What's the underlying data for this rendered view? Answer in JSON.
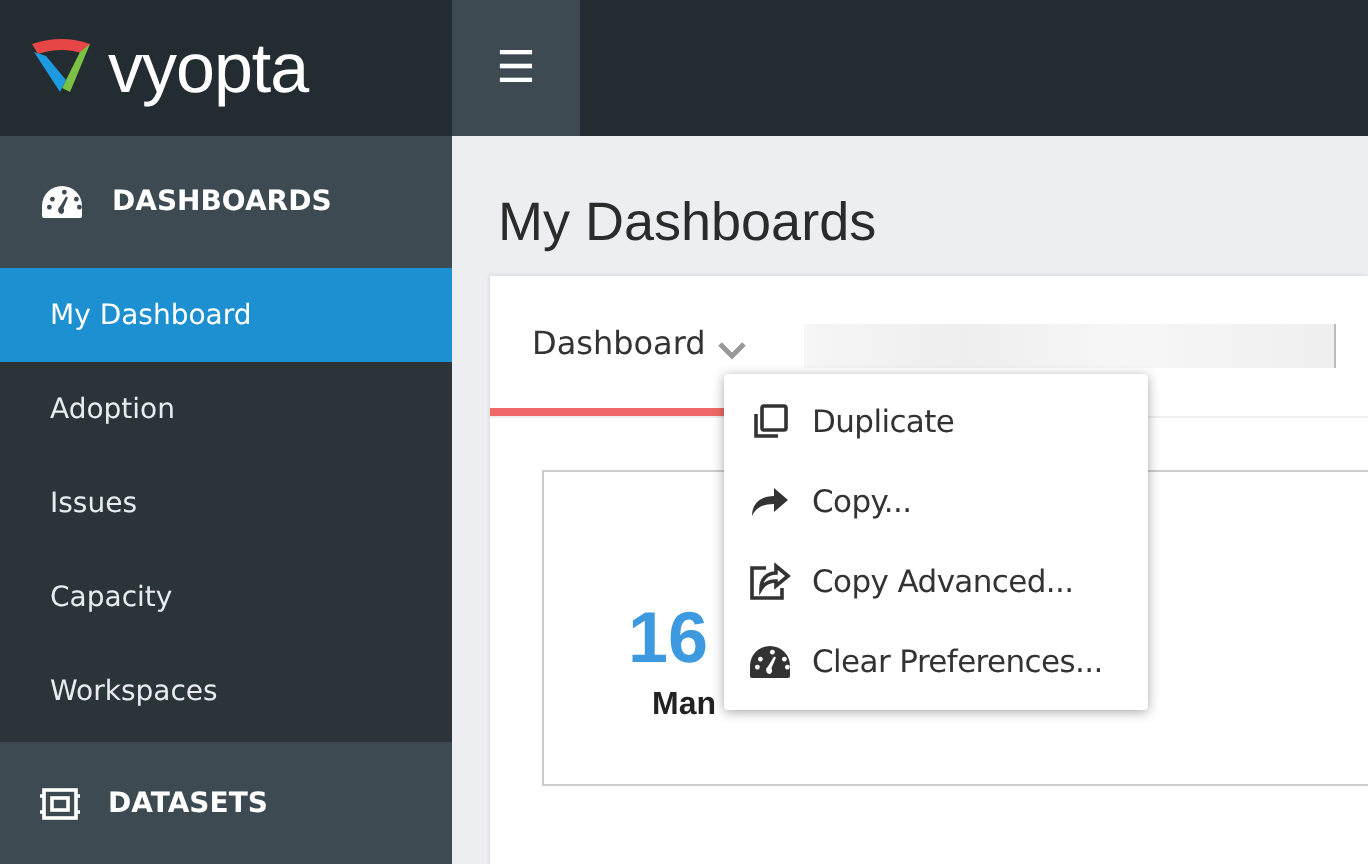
{
  "brand": {
    "name": "vyopta"
  },
  "menu_button": {
    "glyph": "☰"
  },
  "sidebar": {
    "sections": [
      {
        "title": "DASHBOARDS",
        "items": [
          {
            "label": "My Dashboard",
            "selected": true
          },
          {
            "label": "Adoption",
            "selected": false
          },
          {
            "label": "Issues",
            "selected": false
          },
          {
            "label": "Capacity",
            "selected": false
          },
          {
            "label": "Workspaces",
            "selected": false
          }
        ]
      },
      {
        "title": "DATASETS"
      }
    ]
  },
  "page_title": "My Dashboards",
  "tabs": [
    {
      "label": "Dashboard",
      "selected": true,
      "kind": "dropdown"
    },
    {
      "kind": "blurred",
      "selected": false
    }
  ],
  "tile": {
    "value": "16",
    "label": "Man"
  },
  "dropdown_menu": [
    {
      "label": "Duplicate"
    },
    {
      "label": "Copy..."
    },
    {
      "label": "Copy Advanced..."
    },
    {
      "label": "Clear Preferences..."
    }
  ]
}
